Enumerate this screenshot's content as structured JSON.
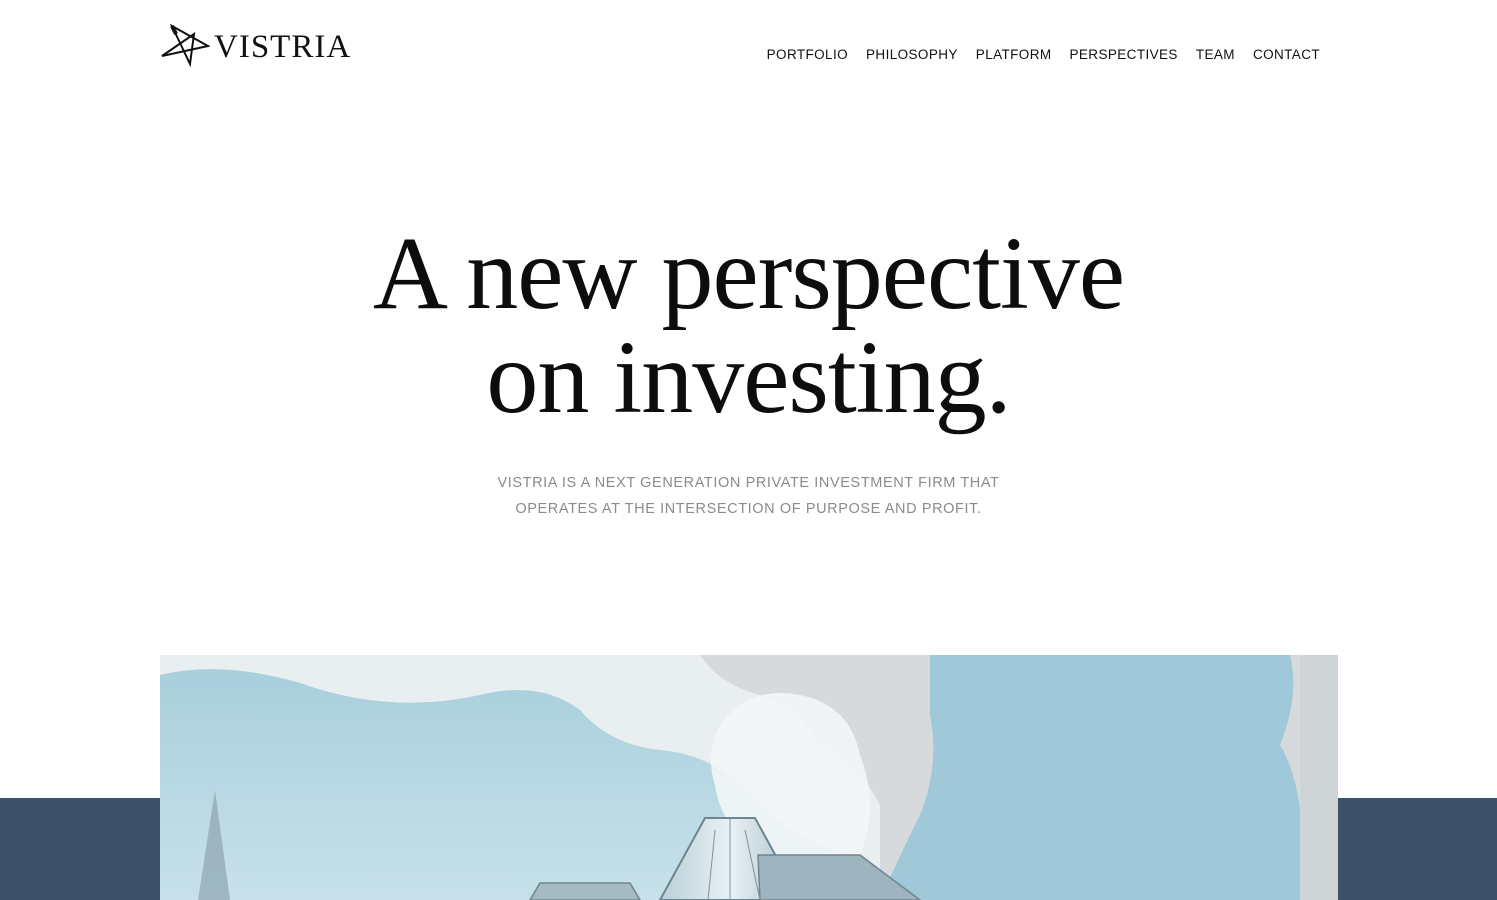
{
  "brand": {
    "name": "VISTRIA",
    "logo_icon": "star-logo-icon"
  },
  "nav": {
    "items": [
      {
        "label": "PORTFOLIO"
      },
      {
        "label": "PHILOSOPHY"
      },
      {
        "label": "PLATFORM"
      },
      {
        "label": "PERSPECTIVES"
      },
      {
        "label": "TEAM"
      },
      {
        "label": "CONTACT"
      }
    ]
  },
  "hero": {
    "title_line1": "A new perspective",
    "title_line2": "on investing.",
    "subtitle_line1": "VISTRIA IS A NEXT GENERATION PRIVATE INVESTMENT FIRM THAT",
    "subtitle_line2": "OPERATES AT THE INTERSECTION OF PURPOSE AND PROFIT."
  },
  "colors": {
    "band": "#3d5269",
    "watercolor_blue": "#9ec8d7",
    "text_gray": "#8b8b8b"
  }
}
